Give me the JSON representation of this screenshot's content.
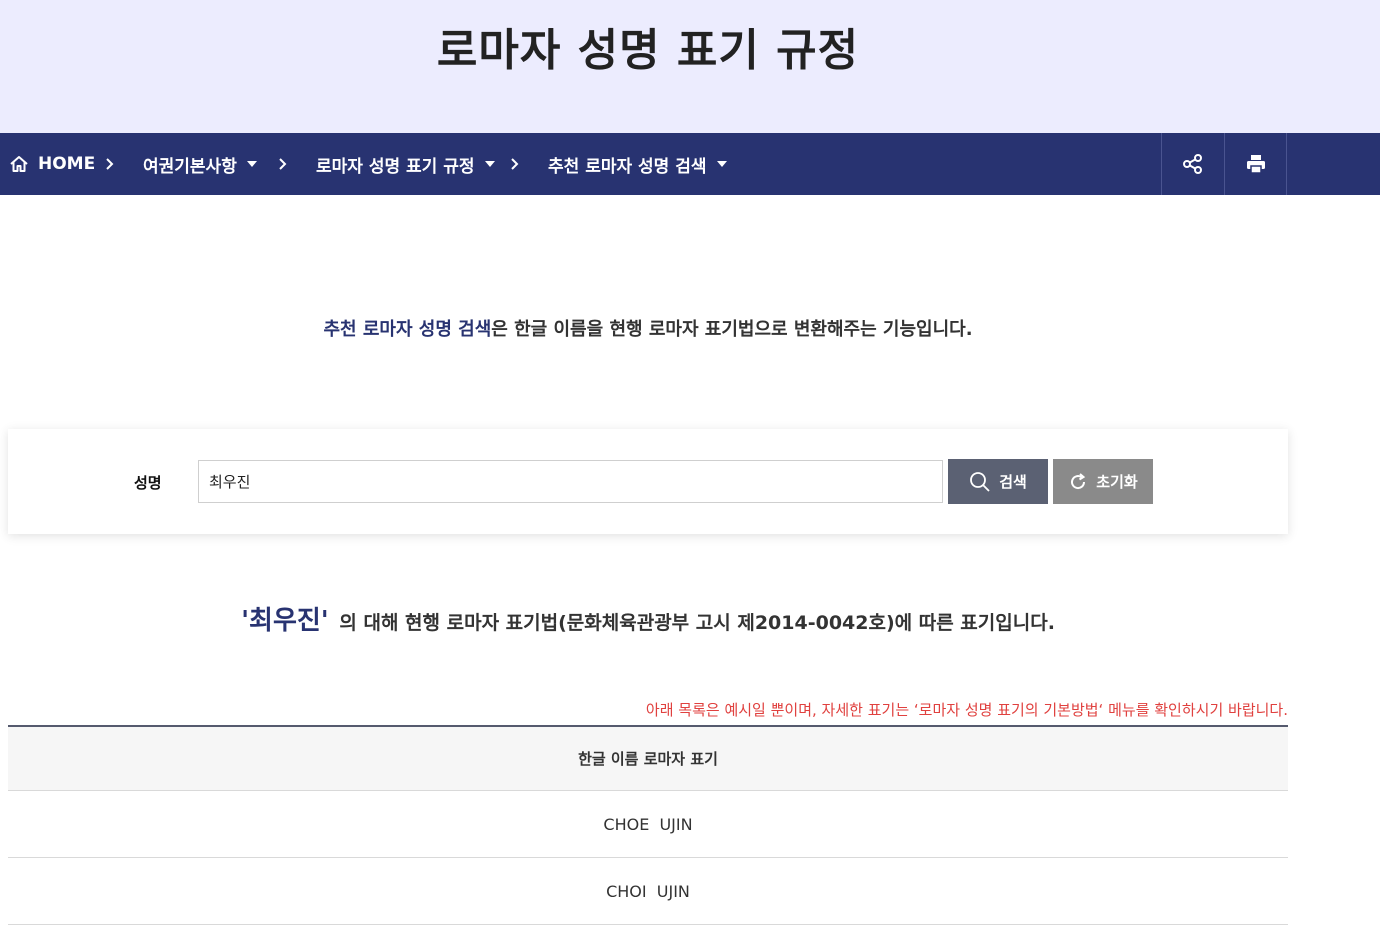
{
  "header": {
    "title": "로마자 성명 표기 규정"
  },
  "breadcrumb": {
    "home": "HOME",
    "items": [
      "여권기본사항",
      "로마자 성명 표기 규정",
      "추천 로마자 성명 검색"
    ],
    "separator": ">"
  },
  "toolbar": {
    "share_icon": "share-icon",
    "print_icon": "print-icon"
  },
  "intro": {
    "highlight": "추천 로마자 성명 검색",
    "rest": "은 한글 이름을 현행 로마자 표기법으로 변환해주는 기능입니다."
  },
  "search": {
    "label": "성명",
    "value": "최우진",
    "search_button": "검색",
    "reset_button": "초기화"
  },
  "result": {
    "quoted_name": "'최우진'",
    "description": "의 대해 현행 로마자 표기법(문화체육관광부 고시 제2014-0042호)에 따른 표기입니다.",
    "notice": "아래 목록은 예시일 뿐이며, 자세한 표기는 ‘로마자 성명 표기의 기본방법‘ 메뉴를 확인하시기 바랍니다."
  },
  "table": {
    "header": "한글 이름 로마자 표기",
    "rows": [
      "CHOE  UJIN",
      "CHOI  UJIN"
    ]
  },
  "colors": {
    "navy": "#283371",
    "header_bg": "#ececfe",
    "notice_red": "#e0413f"
  }
}
